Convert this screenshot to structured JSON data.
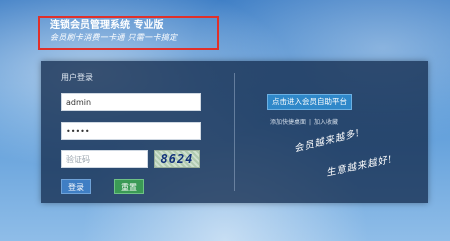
{
  "header": {
    "title": "连锁会员管理系统 专业版",
    "slogan": "会员刷卡消费一卡通  只需一卡搞定"
  },
  "login": {
    "title": "用户登录",
    "username_value": "admin",
    "password_value": "•••••",
    "captcha_placeholder": "验证码",
    "captcha_code": "8624",
    "login_label": "登录",
    "reset_label": "重置"
  },
  "side": {
    "self_service_label": "点击进入会员自助平台",
    "link_homepage": "添加快捷桌面",
    "link_favorite": "加入收藏",
    "link_separator": "|",
    "handwriting_line1": "会员越来越多!",
    "handwriting_line2": "生意越来越好!"
  },
  "colors": {
    "header_border": "#e0302a",
    "login_button": "#3f7ec4",
    "reset_button": "#3b9a55",
    "self_service_button": "#2f88c9"
  }
}
